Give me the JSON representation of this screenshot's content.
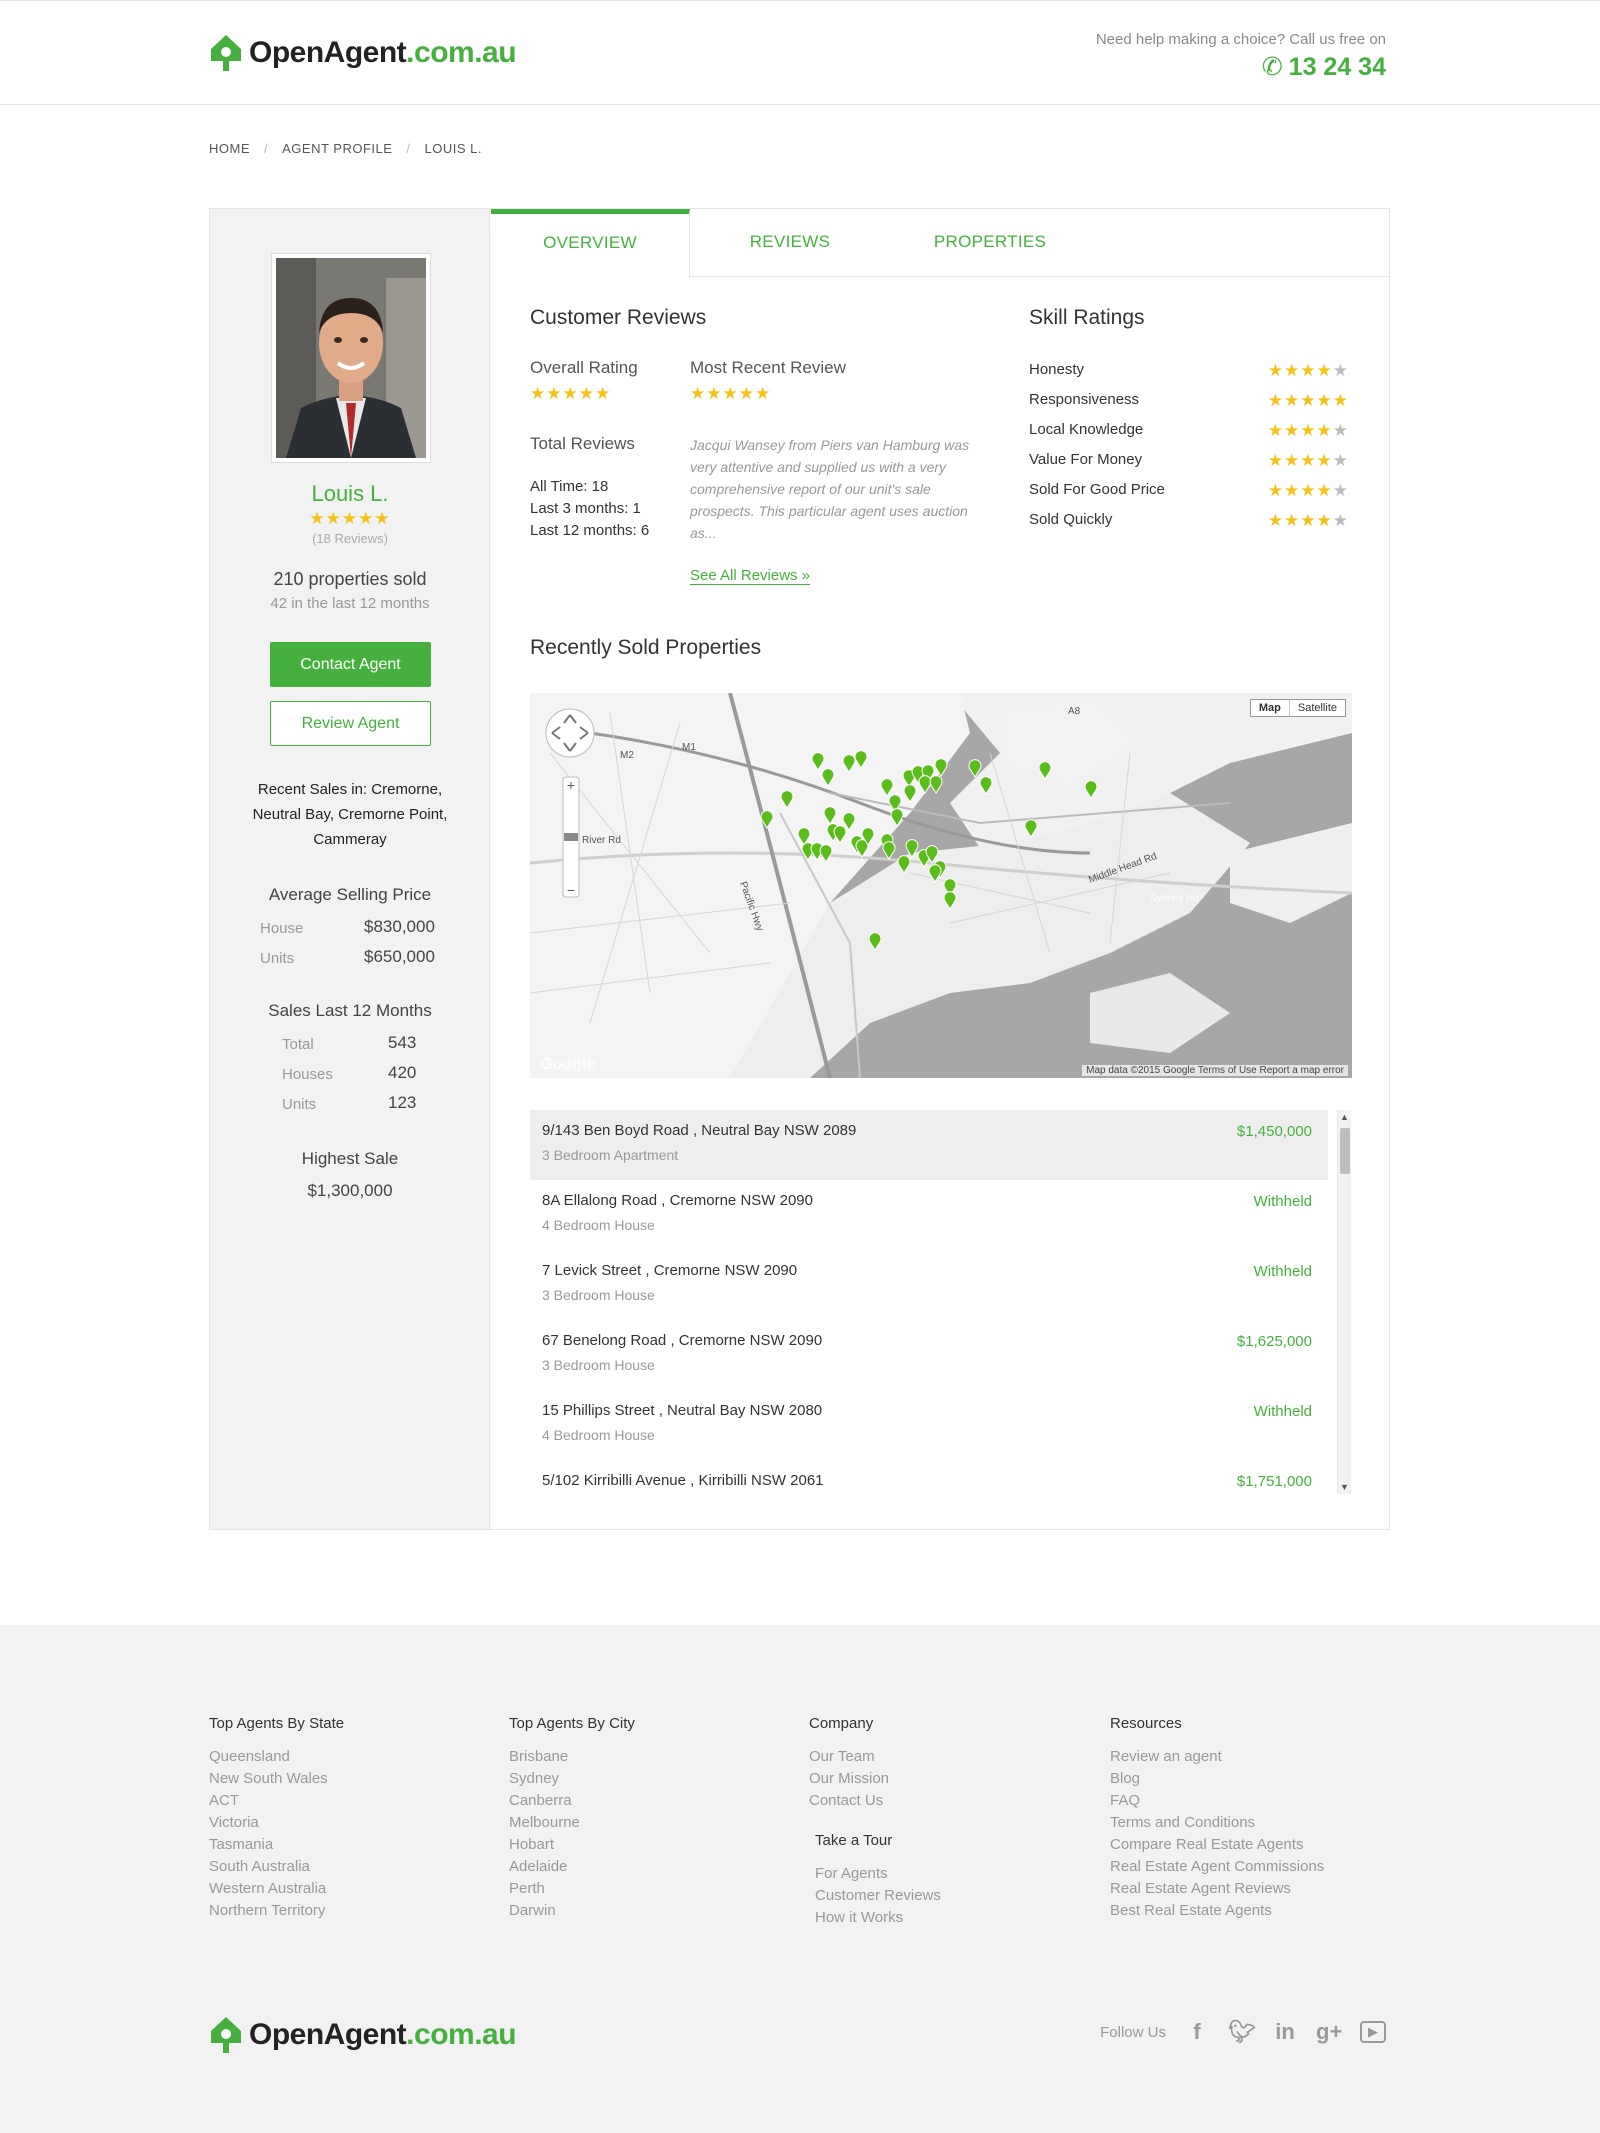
{
  "header": {
    "logo_main": "OpenAgent",
    "logo_domain": ".com.au",
    "help_text": "Need help making a choice? Call us free on",
    "phone": "13 24 34"
  },
  "breadcrumb": [
    "HOME",
    "AGENT PROFILE",
    "LOUIS L."
  ],
  "agent": {
    "name": "Louis L.",
    "stars": 5,
    "reviews_count": "(18 Reviews)",
    "properties_sold": "210 properties sold",
    "sold_recent": "42 in the last 12 months",
    "contact_button": "Contact Agent",
    "review_button": "Review Agent",
    "recent_sales": "Recent Sales in: Cremorne, Neutral Bay, Cremorne Point, Cammeray",
    "avg_title": "Average Selling Price",
    "house_label": "House",
    "house_value": "$830,000",
    "units_label": "Units",
    "units_value": "$650,000",
    "sales_title": "Sales Last 12 Months",
    "sales": [
      {
        "label": "Total",
        "value": "543"
      },
      {
        "label": "Houses",
        "value": "420"
      },
      {
        "label": "Units",
        "value": "123"
      }
    ],
    "highest_title": "Highest Sale",
    "highest_value": "$1,300,000"
  },
  "tabs": [
    "OVERVIEW",
    "REVIEWS",
    "PROPERTIES"
  ],
  "reviews": {
    "title": "Customer Reviews",
    "overall_label": "Overall Rating",
    "recent_label": "Most Recent Review",
    "total_label": "Total Reviews",
    "all_time": "All Time: 18",
    "last_3": "Last 3 months: 1",
    "last_12": "Last 12 months: 6",
    "quote": "Jacqui Wansey from Piers van Hamburg was very attentive and supplied us with a very comprehensive report of our unit's sale prospects. This particular agent uses auction as...",
    "see_all": "See All Reviews »"
  },
  "skills": {
    "title": "Skill Ratings",
    "items": [
      {
        "label": "Honesty",
        "stars": 4
      },
      {
        "label": "Responsiveness",
        "stars": 5
      },
      {
        "label": "Local Knowledge",
        "stars": 4
      },
      {
        "label": "Value For Money",
        "stars": 4
      },
      {
        "label": "Sold For Good Price",
        "stars": 4
      },
      {
        "label": "Sold Quickly",
        "stars": 4
      }
    ]
  },
  "sold": {
    "title": "Recently Sold Properties",
    "map_type": [
      "Map",
      "Satellite"
    ],
    "map_footer": "Map data ©2015 Google   Terms of Use   Report a map error",
    "map_brand": "Google",
    "map_labels": [
      "River Rd",
      "Pacific Hwy",
      "Middle Head Rd",
      "Sydney Ha",
      "M2",
      "M1",
      "A8"
    ],
    "properties": [
      {
        "address": "9/143 Ben Boyd Road , Neutral Bay NSW 2089",
        "type": "3 Bedroom Apartment",
        "price": "$1,450,000"
      },
      {
        "address": "8A Ellalong Road , Cremorne NSW 2090",
        "type": "4 Bedroom House",
        "price": "Withheld"
      },
      {
        "address": "7 Levick Street , Cremorne NSW 2090",
        "type": "3 Bedroom House",
        "price": "Withheld"
      },
      {
        "address": "67 Benelong Road , Cremorne NSW 2090",
        "type": "3 Bedroom House",
        "price": "$1,625,000"
      },
      {
        "address": "15 Phillips Street , Neutral Bay NSW 2080",
        "type": "4 Bedroom House",
        "price": "Withheld"
      },
      {
        "address": "5/102 Kirribilli Avenue , Kirribilli NSW 2061",
        "type": "",
        "price": "$1,751,000"
      }
    ]
  },
  "footer": {
    "col1": {
      "title": "Top Agents By State",
      "links": [
        "Queensland",
        "New South Wales",
        "ACT",
        "Victoria",
        "Tasmania",
        "South Australia",
        "Western Australia",
        "Northern Territory"
      ]
    },
    "col2": {
      "title": "Top Agents By City",
      "links": [
        "Brisbane",
        "Sydney",
        "Canberra",
        "Melbourne",
        "Hobart",
        "Adelaide",
        "Perth",
        "Darwin"
      ]
    },
    "col3": {
      "title": "Company",
      "links": [
        "Our Team",
        "Our Mission",
        "Contact Us"
      ],
      "sub_title": "Take a Tour",
      "sub_links": [
        "For Agents",
        "Customer Reviews",
        "How it Works"
      ]
    },
    "col4": {
      "title": "Resources",
      "links": [
        "Review an agent",
        "Blog",
        "FAQ",
        "Terms and Conditions",
        "Compare Real Estate Agents",
        "Real Estate Agent Commissions",
        "Real Estate Agent Reviews",
        "Best Real Estate Agents"
      ]
    },
    "follow": "Follow Us",
    "social": [
      "facebook-icon",
      "twitter-icon",
      "linkedin-icon",
      "googleplus-icon",
      "youtube-icon"
    ]
  },
  "colors": {
    "brand_green": "#46b03f",
    "star_yellow": "#f3c21b"
  }
}
